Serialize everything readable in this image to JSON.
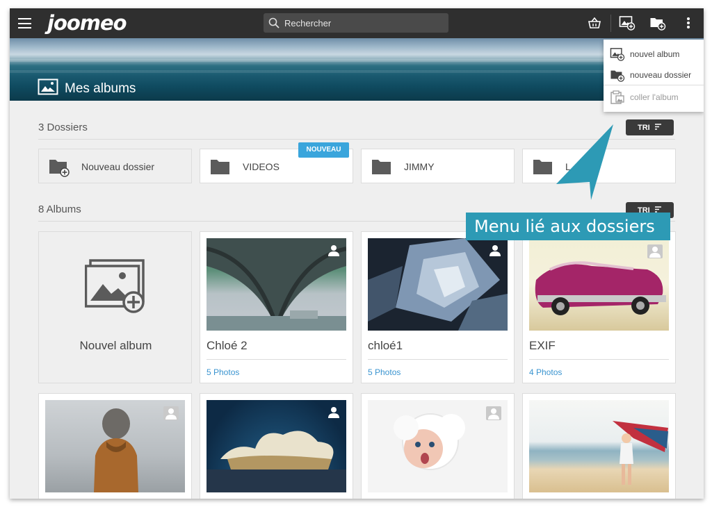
{
  "app": {
    "logo": "joomeo"
  },
  "search": {
    "placeholder": "Rechercher"
  },
  "toolbar": {
    "icons": [
      "basket-icon",
      "new-album-icon",
      "new-folder-icon",
      "more-vert-icon"
    ]
  },
  "banner": {
    "title": "Mes albums"
  },
  "dropdown": {
    "items": [
      {
        "label": "nouvel album",
        "icon": "new-album-icon",
        "enabled": true
      },
      {
        "label": "nouveau dossier",
        "icon": "new-folder-icon",
        "enabled": true
      },
      {
        "label": "coller l'album",
        "icon": "paste-album-icon",
        "enabled": false
      }
    ]
  },
  "folders": {
    "title": "3 Dossiers",
    "sort_label": "TRI",
    "new_badge": "NOUVEAU",
    "items": [
      {
        "name": "Nouveau dossier"
      },
      {
        "name": "VIDEOS"
      },
      {
        "name": "JIMMY"
      },
      {
        "name": "L"
      }
    ]
  },
  "albums": {
    "title": "8 Albums",
    "sort_label": "TRI",
    "new_album_label": "Nouvel album",
    "items": [
      {
        "name": "Chloé 2",
        "count": "5 Photos"
      },
      {
        "name": "chloé1",
        "count": "5 Photos"
      },
      {
        "name": "EXIF",
        "count": "4 Photos"
      }
    ]
  },
  "callout": {
    "text": "Menu lié aux dossiers"
  },
  "colors": {
    "topbar": "#2f2f2f",
    "accent": "#3aa5dc",
    "callout": "#2d9ab5",
    "link": "#3a94d0"
  }
}
